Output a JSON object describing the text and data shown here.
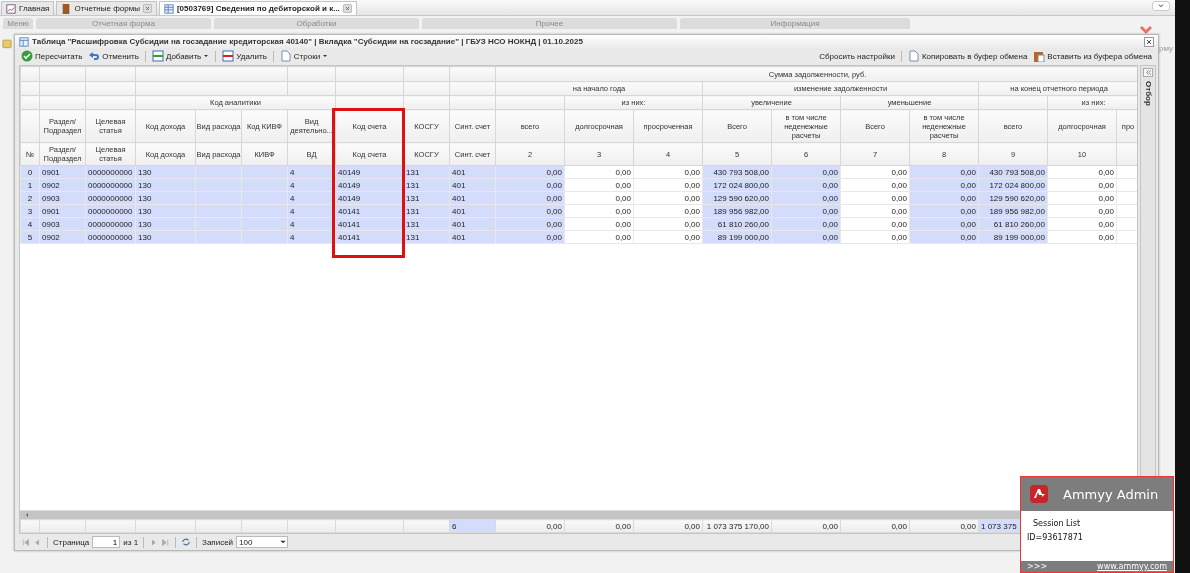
{
  "app_tabs": [
    {
      "label": "Главная",
      "selected": false,
      "closable": false
    },
    {
      "label": "Отчетные формы",
      "selected": false,
      "closable": true
    },
    {
      "label": "[0503769] Сведения по дебиторской и к...",
      "selected": true,
      "closable": true
    }
  ],
  "ribbon_groups": [
    "Меню",
    "Отчетная форма",
    "Обработки",
    "Прочее",
    "Информация"
  ],
  "side_text": "рму",
  "dialog": {
    "title": "Таблица \"Расшифровка Субсидии на госзадание кредиторская 40140\" | Вкладка \"Субсидии на госзадание\" | ГБУЗ НСО НОКНД | 01.10.2025",
    "toolbar_left": [
      [
        {
          "label": "Пересчитать",
          "dropdown": false
        },
        {
          "label": "Отменить",
          "dropdown": false
        }
      ],
      [
        {
          "label": "Добавить",
          "dropdown": true
        }
      ],
      [
        {
          "label": "Удалить",
          "dropdown": false
        }
      ],
      [
        {
          "label": "Строки",
          "dropdown": true
        }
      ]
    ],
    "toolbar_right": [
      [
        "Сбросить настройки"
      ],
      [
        "Копировать в буфер обмена",
        "Вставить из буфера обмена"
      ]
    ],
    "filter_panel": {
      "label": "Отбор"
    },
    "header_rows": [
      [
        "Сумма задолженности, руб."
      ],
      [
        "на начало года",
        "изменение задолженности",
        "на конец отчетного периода"
      ],
      [
        "Код аналитики",
        "из них:",
        "увеличение",
        "уменьшение",
        "из них:"
      ]
    ],
    "columns": [
      {
        "kind": "index",
        "sublabel": "№",
        "editable": false
      },
      {
        "kind": "code",
        "label": "Раздел/ Подраздел",
        "sublabel": "Раздел/ Подраздел",
        "editable": false
      },
      {
        "kind": "code",
        "label": "Целевая статья",
        "sublabel": "Целевая статья",
        "editable": false
      },
      {
        "kind": "code",
        "label": "Код дохода",
        "sublabel": "Код дохода",
        "editable": false
      },
      {
        "kind": "code",
        "label": "Вид расхода",
        "sublabel": "Вид расхода",
        "editable": false
      },
      {
        "kind": "code",
        "label": "Код КИВФ",
        "sublabel": "КИВФ",
        "editable": false
      },
      {
        "kind": "code",
        "label": "Вид деятельно...",
        "sublabel": "ВД",
        "editable": false
      },
      {
        "kind": "code",
        "label": "Код счета",
        "sublabel": "Код счета",
        "editable": false,
        "highlighted": true
      },
      {
        "kind": "code",
        "label": "КОСГУ",
        "sublabel": "КОСГУ",
        "editable": false
      },
      {
        "kind": "code",
        "label": "Синт. счет",
        "sublabel": "Синт. счет",
        "editable": false
      },
      {
        "kind": "amount",
        "label": "всего",
        "sublabel": "2",
        "editable": false
      },
      {
        "kind": "amount",
        "label": "долгосрочная",
        "sublabel": "3",
        "editable": true
      },
      {
        "kind": "amount",
        "label": "просроченная",
        "sublabel": "4",
        "editable": true
      },
      {
        "kind": "amount",
        "label": "Всего",
        "sublabel": "5",
        "editable": false
      },
      {
        "kind": "amount",
        "label": "в том числе неденежные расчеты",
        "sublabel": "6",
        "editable": false
      },
      {
        "kind": "amount",
        "label": "Всего",
        "sublabel": "7",
        "editable": true
      },
      {
        "kind": "amount",
        "label": "в том числе неденежные расчеты",
        "sublabel": "8",
        "editable": false
      },
      {
        "kind": "amount",
        "label": "всего",
        "sublabel": "9",
        "editable": false
      },
      {
        "kind": "amount",
        "label": "долгосрочная",
        "sublabel": "10",
        "editable": true
      },
      {
        "kind": "amount",
        "label": "про",
        "editable": true
      }
    ],
    "rows": [
      {
        "no": "0",
        "section": "0901",
        "target_item": "0000000000",
        "income_code": "130",
        "activity_type": "4",
        "account_code": "40149",
        "kosgu": "131",
        "synthetic_account": "401",
        "c2": "0,00",
        "c3": "0,00",
        "c4": "0,00",
        "c5": "430 793 508,00",
        "c6": "0,00",
        "c7": "0,00",
        "c8": "0,00",
        "c9": "430 793 508,00",
        "c10": "0,00"
      },
      {
        "no": "1",
        "section": "0902",
        "target_item": "0000000000",
        "income_code": "130",
        "activity_type": "4",
        "account_code": "40149",
        "kosgu": "131",
        "synthetic_account": "401",
        "c2": "0,00",
        "c3": "0,00",
        "c4": "0,00",
        "c5": "172 024 800,00",
        "c6": "0,00",
        "c7": "0,00",
        "c8": "0,00",
        "c9": "172 024 800,00",
        "c10": "0,00"
      },
      {
        "no": "2",
        "section": "0903",
        "target_item": "0000000000",
        "income_code": "130",
        "activity_type": "4",
        "account_code": "40149",
        "kosgu": "131",
        "synthetic_account": "401",
        "c2": "0,00",
        "c3": "0,00",
        "c4": "0,00",
        "c5": "129 590 620,00",
        "c6": "0,00",
        "c7": "0,00",
        "c8": "0,00",
        "c9": "129 590 620,00",
        "c10": "0,00"
      },
      {
        "no": "3",
        "section": "0901",
        "target_item": "0000000000",
        "income_code": "130",
        "activity_type": "4",
        "account_code": "40141",
        "kosgu": "131",
        "synthetic_account": "401",
        "c2": "0,00",
        "c3": "0,00",
        "c4": "0,00",
        "c5": "189 956 982,00",
        "c6": "0,00",
        "c7": "0,00",
        "c8": "0,00",
        "c9": "189 956 982,00",
        "c10": "0,00"
      },
      {
        "no": "4",
        "section": "0903",
        "target_item": "0000000000",
        "income_code": "130",
        "activity_type": "4",
        "account_code": "40141",
        "kosgu": "131",
        "synthetic_account": "401",
        "c2": "0,00",
        "c3": "0,00",
        "c4": "0,00",
        "c5": "61 810 260,00",
        "c6": "0,00",
        "c7": "0,00",
        "c8": "0,00",
        "c9": "61 810 260,00",
        "c10": "0,00"
      },
      {
        "no": "5",
        "section": "0902",
        "target_item": "0000000000",
        "income_code": "130",
        "activity_type": "4",
        "account_code": "40141",
        "kosgu": "131",
        "synthetic_account": "401",
        "c2": "0,00",
        "c3": "0,00",
        "c4": "0,00",
        "c5": "89 199 000,00",
        "c6": "0,00",
        "c7": "0,00",
        "c8": "0,00",
        "c9": "89 199 000,00",
        "c10": "0,00"
      }
    ],
    "totals": {
      "synthetic_account": {
        "text": "6",
        "highlighted": true
      },
      "c2": {
        "text": "0,00",
        "highlighted": false
      },
      "c3": {
        "text": "0,00",
        "highlighted": false
      },
      "c4": {
        "text": "0,00",
        "highlighted": false
      },
      "c5": {
        "text": "1 073 375 170,00",
        "highlighted": false
      },
      "c6": {
        "text": "0,00",
        "highlighted": false
      },
      "c7": {
        "text": "0,00",
        "highlighted": false
      },
      "c8": {
        "text": "0,00",
        "highlighted": false
      },
      "c9": {
        "text": "1 073 375",
        "highlighted": true
      }
    },
    "pager": {
      "page_label": "Страница",
      "page": "1",
      "of": "из 1",
      "records_label": "Записей",
      "page_size": "100"
    }
  },
  "ammyy": {
    "title": "Ammyy Admin",
    "lines": [
      "Session List",
      "ID=93617871"
    ],
    "footer": ">>>",
    "link": "www.ammyy.com"
  }
}
